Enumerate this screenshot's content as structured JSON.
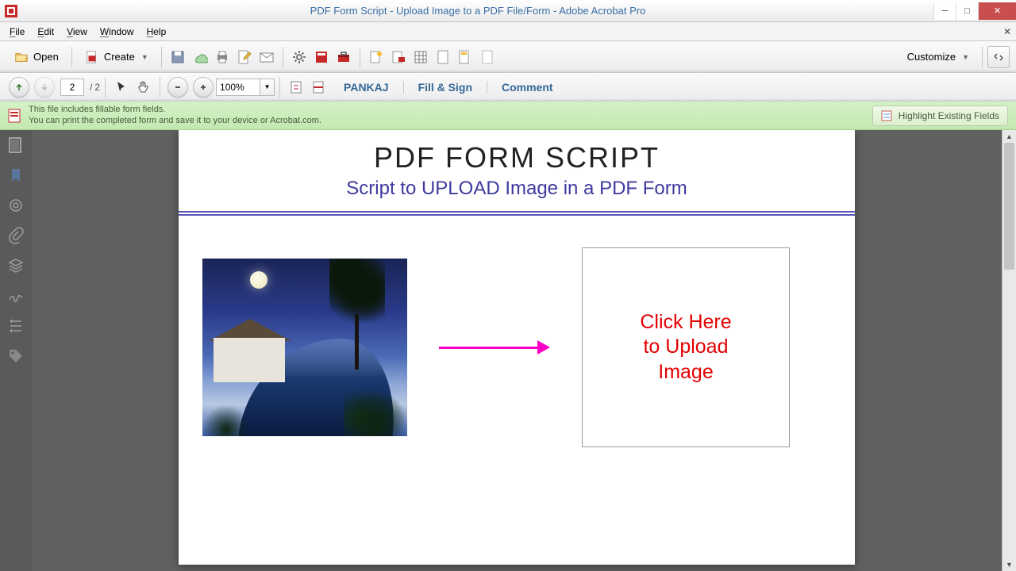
{
  "window": {
    "title": "PDF Form Script - Upload Image to a PDF File/Form - Adobe Acrobat Pro"
  },
  "menu": {
    "file": "File",
    "edit": "Edit",
    "view": "View",
    "window": "Window",
    "help": "Help"
  },
  "toolbar": {
    "open": "Open",
    "create": "Create",
    "customize": "Customize"
  },
  "nav": {
    "current_page": "2",
    "page_sep": "/",
    "total_pages": "2",
    "zoom": "100%"
  },
  "panel": {
    "user": "PANKAJ",
    "fill": "Fill & Sign",
    "comment": "Comment"
  },
  "notif": {
    "line1": "This file includes fillable form fields.",
    "line2": "You can print the completed form and save it to your device or Acrobat.com.",
    "highlight": "Highlight Existing Fields"
  },
  "doc": {
    "title": "PDF FORM SCRIPT",
    "subtitle": "Script to UPLOAD Image in a PDF Form",
    "upload_line1": "Click Here",
    "upload_line2": "to Upload",
    "upload_line3": "Image"
  }
}
